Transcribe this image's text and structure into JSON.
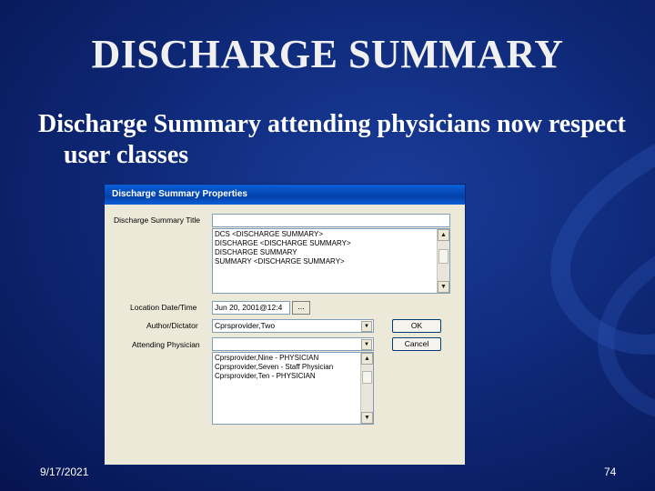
{
  "slide": {
    "title": "DISCHARGE SUMMARY",
    "bullet": "Discharge Summary attending physicians now respect user classes",
    "date": "9/17/2021",
    "page_number": "74"
  },
  "dialog": {
    "title": "Discharge Summary Properties",
    "labels": {
      "summary_title": "Discharge Summary Title",
      "location_datetime": "Location Date/Time",
      "author": "Author/Dictator",
      "attending": "Attending Physician"
    },
    "title_field_value": "",
    "title_list": [
      "DCS <DISCHARGE SUMMARY>",
      "DISCHARGE <DISCHARGE SUMMARY>",
      "DISCHARGE SUMMARY",
      "SUMMARY <DISCHARGE SUMMARY>"
    ],
    "location_value": "Jun 20, 2001@12:4",
    "ellipsis_label": "...",
    "author_value": "Cprsprovider,Two",
    "attending_value": "",
    "attending_list": [
      "Cprsprovider,Nine - PHYSICIAN",
      "Cprsprovider,Seven - Staff Physician",
      "Cprsprovider,Ten - PHYSICIAN"
    ],
    "ok_label": "OK",
    "cancel_label": "Cancel"
  },
  "colors": {
    "background": "#0f2a7a",
    "titlebar": "#0a5fd8",
    "dialog_face": "#ece9d8"
  }
}
